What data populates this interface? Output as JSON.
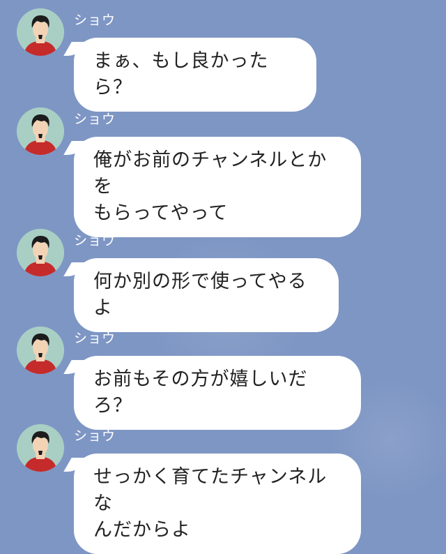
{
  "chat": {
    "messages": [
      {
        "sender": "ショウ",
        "text": "まぁ、もし良かったら？"
      },
      {
        "sender": "ショウ",
        "text": "俺がお前のチャンネルとかを\nもらってやって"
      },
      {
        "sender": "ショウ",
        "text": "何か別の形で使ってやるよ"
      },
      {
        "sender": "ショウ",
        "text": "お前もその方が嬉しいだろ？"
      },
      {
        "sender": "ショウ",
        "text": "せっかく育てたチャンネルな\nんだからよ"
      }
    ]
  },
  "colors": {
    "background": "#7e96c4",
    "bubble": "#ffffff",
    "avatar_bg": "#a9cfc4",
    "shirt": "#c52b2b",
    "hair": "#1c1c1c",
    "skin": "#f2d3b6"
  },
  "icons": {
    "avatar": "man-avatar-icon"
  }
}
